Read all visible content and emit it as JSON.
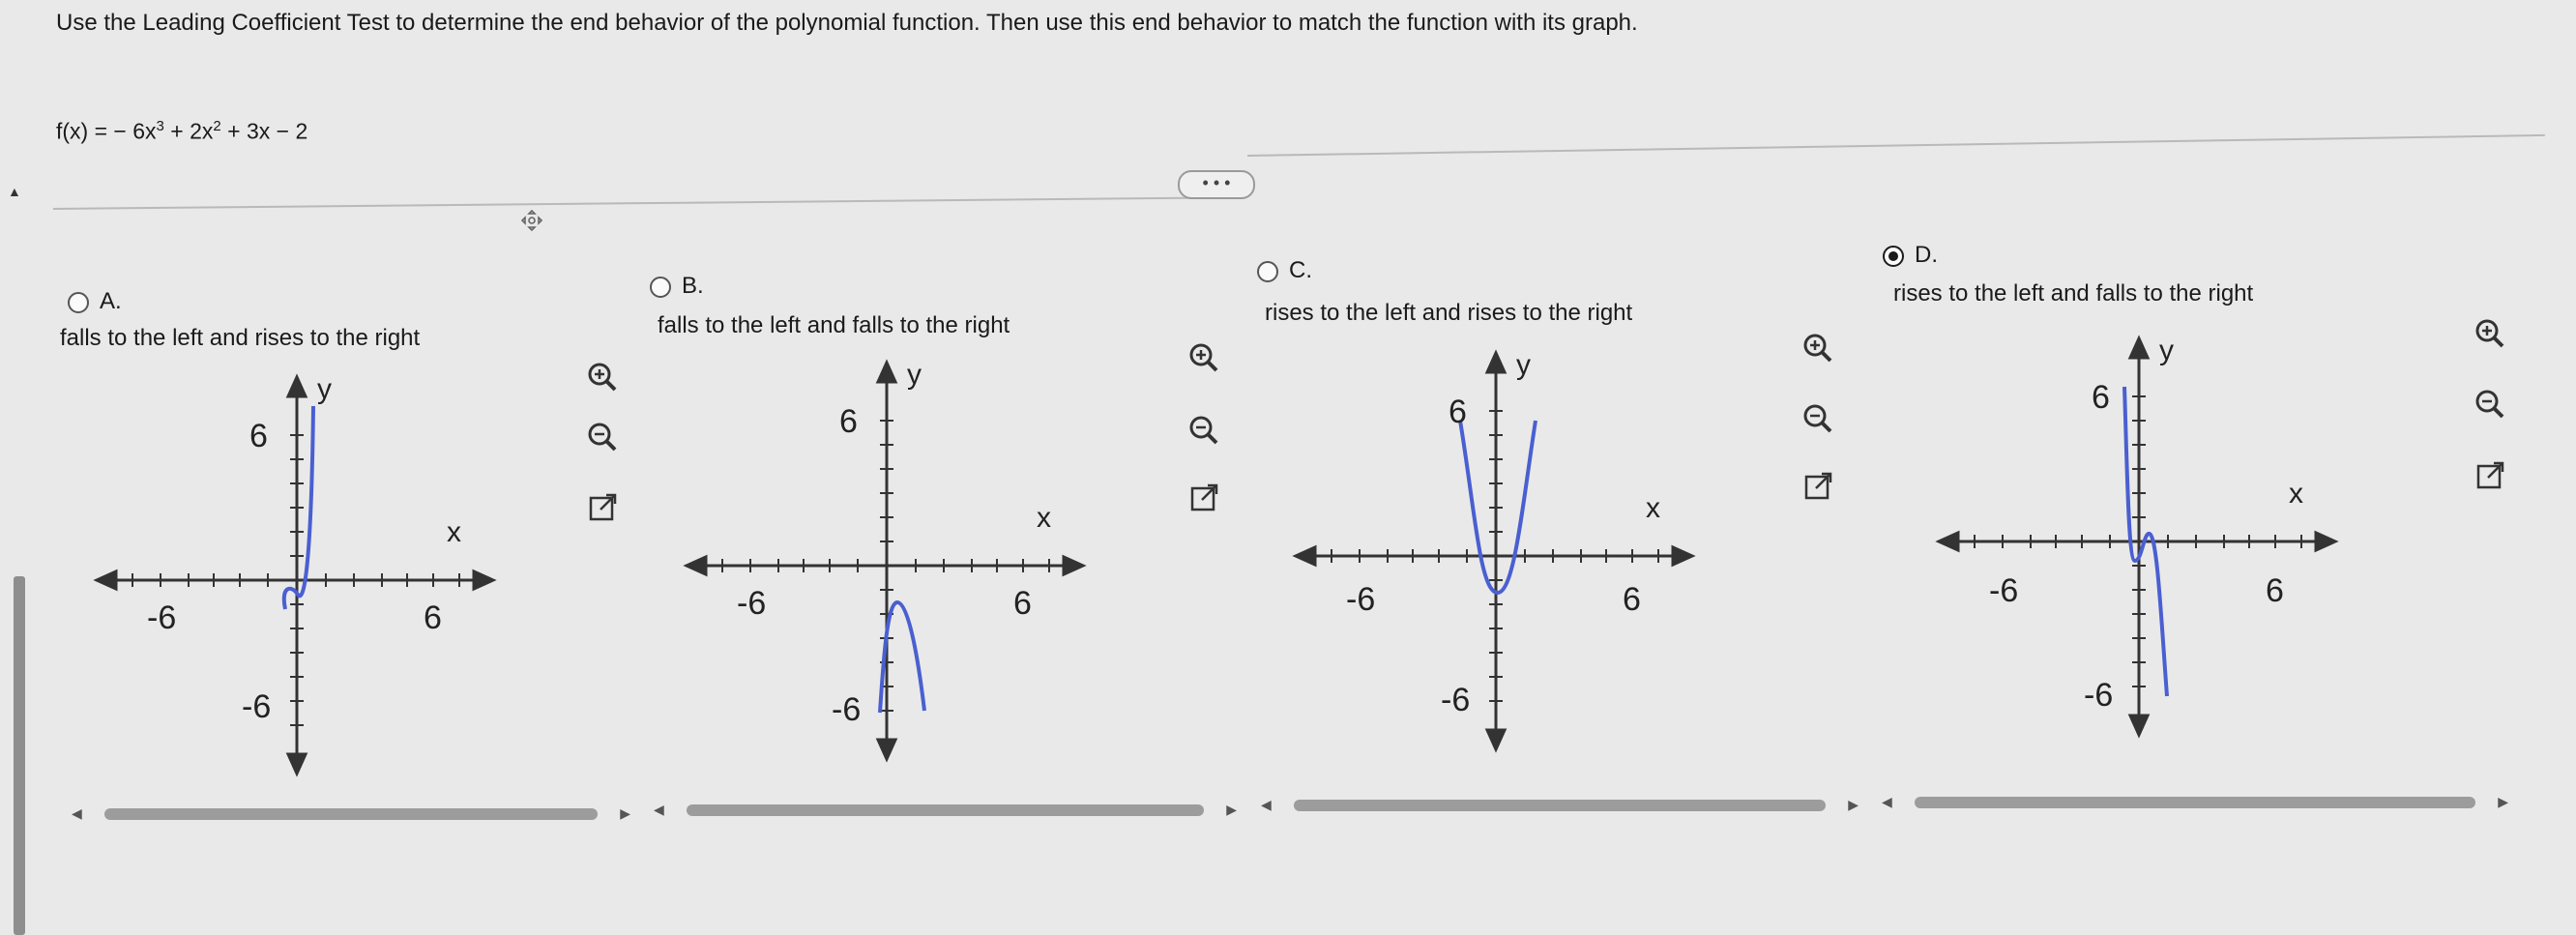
{
  "question": {
    "instruction": "Use the Leading Coefficient Test to determine the end behavior of the polynomial function. Then use this end behavior to match the function with its graph.",
    "function_prefix": "f(x) = − 6x",
    "exp1": "3",
    "function_mid": " + 2x",
    "exp2": "2",
    "function_suffix": " + 3x − 2",
    "more_label": "• • •"
  },
  "options": [
    {
      "letter": "A.",
      "description": "falls to the left and rises to the right",
      "selected": false,
      "graph": {
        "y_label": "y",
        "x_label": "x",
        "tick_y_pos": "6",
        "tick_y_neg": "-6",
        "tick_x_neg": "-6",
        "tick_x_pos": "6"
      }
    },
    {
      "letter": "B.",
      "description": "falls to the left and falls to the right",
      "selected": false,
      "graph": {
        "y_label": "y",
        "x_label": "x",
        "tick_y_pos": "6",
        "tick_y_neg": "-6",
        "tick_x_neg": "-6",
        "tick_x_pos": "6"
      }
    },
    {
      "letter": "C.",
      "description": "rises to the left and rises to the right",
      "selected": false,
      "graph": {
        "y_label": "y",
        "x_label": "x",
        "tick_y_pos": "6",
        "tick_y_neg": "-6",
        "tick_x_neg": "-6",
        "tick_x_pos": "6"
      }
    },
    {
      "letter": "D.",
      "description": "rises to the left and falls to the right",
      "selected": true,
      "graph": {
        "y_label": "y",
        "x_label": "x",
        "tick_y_pos": "6",
        "tick_y_neg": "-6",
        "tick_x_neg": "-6",
        "tick_x_pos": "6"
      }
    }
  ],
  "icons": {
    "zoom_in": "zoom-in-icon",
    "zoom_out": "zoom-out-icon",
    "popout": "external-link-icon",
    "drag": "move-handle-icon"
  },
  "colors": {
    "curve": "#4a5fd0",
    "axis": "#3a3a3a",
    "accent": "#1a1a1a"
  }
}
